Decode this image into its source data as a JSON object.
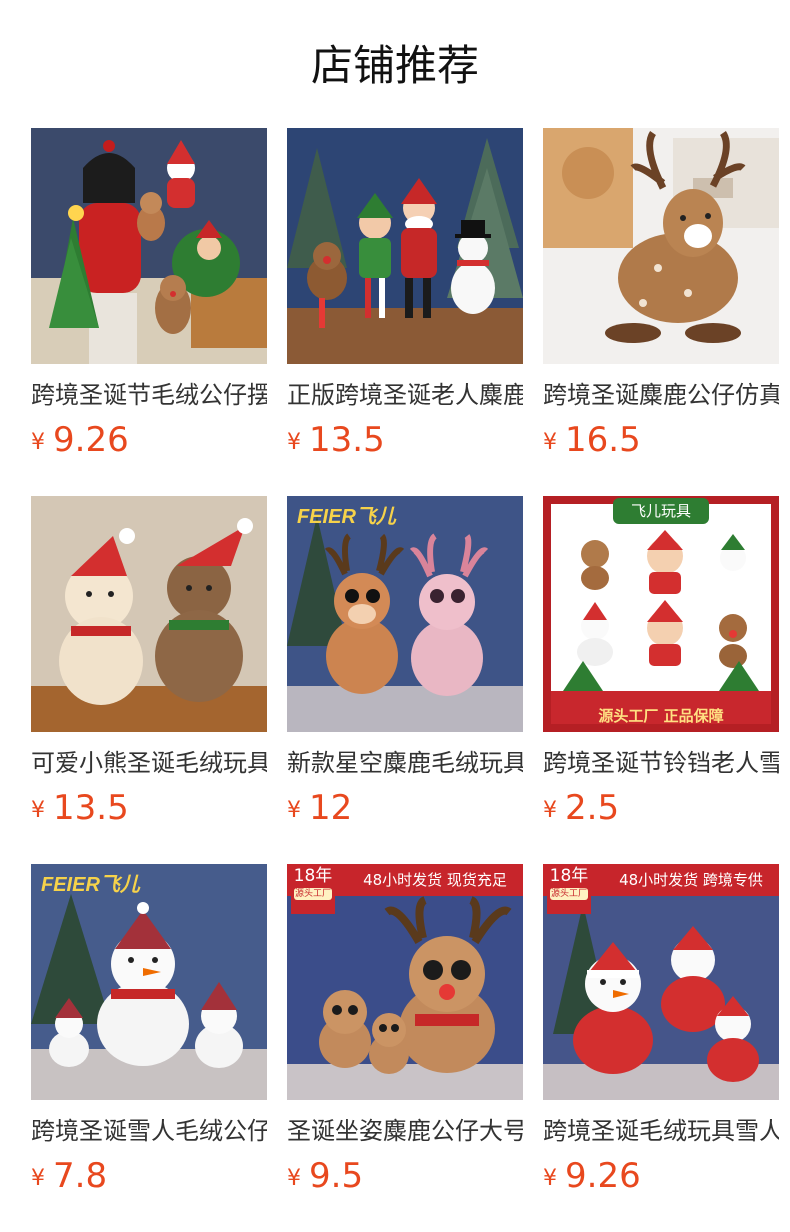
{
  "section_title": "店铺推荐",
  "products": [
    {
      "name": "跨境圣诞节毛绒公仔摆件",
      "currency": "¥",
      "price": "9.26",
      "image": "christmas-plush-girl-tree-reindeer"
    },
    {
      "name": "正版跨境圣诞老人麋鹿雪人",
      "currency": "¥",
      "price": "13.5",
      "image": "santa-elf-snowman-reindeer-plush"
    },
    {
      "name": "跨境圣诞麋鹿公仔仿真玩具",
      "currency": "¥",
      "price": "16.5",
      "image": "spotted-deer-plush"
    },
    {
      "name": "可爱小熊圣诞毛绒玩具",
      "currency": "¥",
      "price": "13.5",
      "image": "christmas-teddy-bears"
    },
    {
      "name": "新款星空麋鹿毛绒玩具",
      "currency": "¥",
      "price": "12",
      "image": "starry-reindeer-plush",
      "brand": "FEIER飞儿"
    },
    {
      "name": "跨境圣诞节铃铛老人雪人",
      "currency": "¥",
      "price": "2.5",
      "image": "christmas-ornament-collage",
      "banner": "飞儿玩具",
      "footer_badge": "源头工厂 正品保障"
    },
    {
      "name": "跨境圣诞雪人毛绒公仔",
      "currency": "¥",
      "price": "7.8",
      "image": "snowman-plush-family",
      "brand": "FEIER飞儿"
    },
    {
      "name": "圣诞坐姿麋鹿公仔大号",
      "currency": "¥",
      "price": "9.5",
      "image": "sitting-reindeer-plush",
      "badge_years": "18年",
      "badge_sub": "源头工厂",
      "banner": "48小时发货 现货充足"
    },
    {
      "name": "跨境圣诞毛绒玩具雪人",
      "currency": "¥",
      "price": "9.26",
      "image": "santa-snowman-red-coat",
      "badge_years": "18年",
      "badge_sub": "源头工厂",
      "banner": "48小时发货 跨境专供"
    }
  ]
}
